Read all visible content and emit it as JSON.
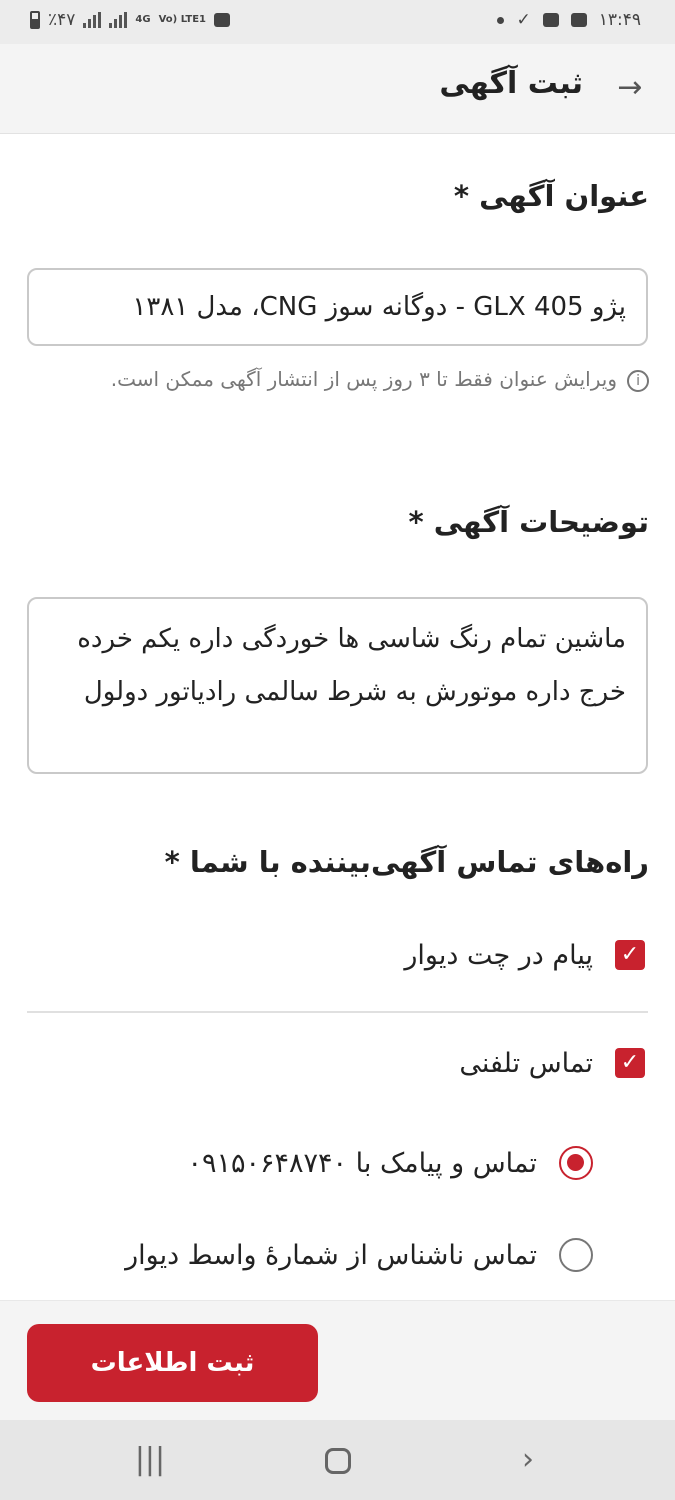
{
  "status_bar": {
    "battery": "٪۴۷",
    "network": "4G",
    "volte": "Vo) LTE1",
    "time": "۱۳:۴۹"
  },
  "app_bar": {
    "title": "ثبت آگهی",
    "back_icon": "arrow-right-icon"
  },
  "form": {
    "title_label": "عنوان آگهی *",
    "title_value": "پژو 405 GLX - دوگانه سوز CNG، مدل ۱۳۸۱",
    "title_hint": "ویرایش عنوان فقط تا ۳ روز پس از انتشار آگهی ممکن است.",
    "description_label": "توضیحات آگهی *",
    "description_value": "ماشین تمام رنگ شاسی ها خوردگی داره یکم خرده خرج داره موتورش به شرط سالمی رادیاتور دولول",
    "contact_label": "راه‌های تماس آگهی‌بیننده با شما *",
    "contact_options": [
      {
        "label": "پیام در چت دیوار",
        "checked": true
      },
      {
        "label": "تماس تلفنی",
        "checked": true
      }
    ],
    "phone_options": [
      {
        "label": "تماس و پیامک با ۰۹۱۵۰۶۴۸۷۴۰",
        "selected": true
      },
      {
        "label": "تماس ناشناس از شمارهٔ واسط دیوار",
        "selected": false
      }
    ],
    "submit_label": "ثبت اطلاعات"
  },
  "colors": {
    "accent": "#c8222e",
    "field_border": "#c9c9c9",
    "app_bar_bg": "#f4f4f4"
  }
}
